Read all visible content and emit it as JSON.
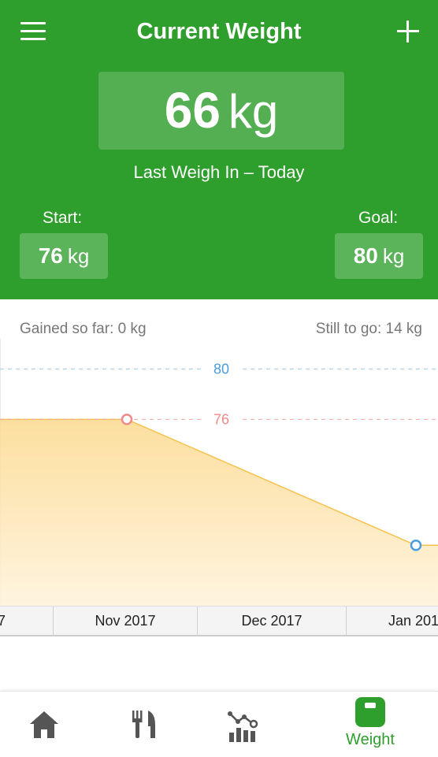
{
  "header": {
    "title": "Current Weight",
    "current_value": "66",
    "current_unit": "kg",
    "last_weigh_in": "Last Weigh In – Today",
    "start_label": "Start:",
    "start_value": "76",
    "start_unit": "kg",
    "goal_label": "Goal:",
    "goal_value": "80",
    "goal_unit": "kg"
  },
  "stats": {
    "gained": "Gained so far: 0 kg",
    "remaining": "Still to go: 14 kg"
  },
  "chart_data": {
    "type": "area",
    "goal_line": 80,
    "goal_label": "80",
    "start_line": 76,
    "start_label": "76",
    "x_ticks": [
      "7",
      "Nov 2017",
      "Dec 2017",
      "Jan 201"
    ],
    "points": [
      {
        "x": "Nov 2017",
        "y": 76
      },
      {
        "x": "Jan 2018",
        "y": 66
      }
    ],
    "colors": {
      "fill": "#fde5b4",
      "line": "#f6c24c",
      "goal": "#4a9edc",
      "start": "#f08a8a"
    }
  },
  "nav": {
    "items": [
      {
        "icon": "home-icon"
      },
      {
        "icon": "fork-knife-icon"
      },
      {
        "icon": "chart-icon"
      },
      {
        "icon": "scale-icon",
        "label": "Weight",
        "active": true
      }
    ]
  },
  "colors": {
    "brand": "#2e9e2c"
  }
}
